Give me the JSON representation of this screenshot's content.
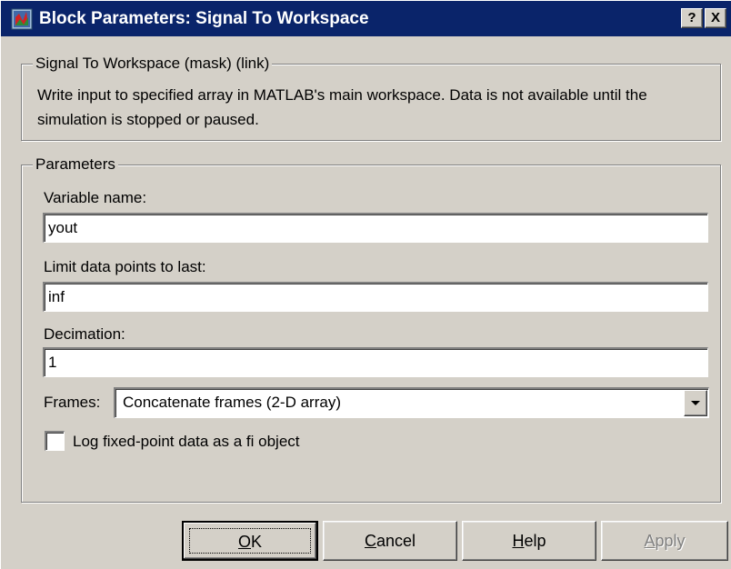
{
  "window": {
    "title": "Block Parameters: Signal To Workspace",
    "help_button": "?",
    "close_button": "X"
  },
  "description_group": {
    "legend": "Signal To Workspace (mask) (link)",
    "text": "Write input to specified array in MATLAB's main workspace.  Data is not available until the simulation is stopped or paused."
  },
  "parameters": {
    "legend": "Parameters",
    "variable_name": {
      "label": "Variable name:",
      "value": "yout"
    },
    "limit_points": {
      "label": "Limit data points to last:",
      "value": "inf"
    },
    "decimation": {
      "label": "Decimation:",
      "value": "1"
    },
    "frames": {
      "label": "Frames:",
      "value": "Concatenate frames (2-D array)"
    },
    "log_fixed_point": {
      "label": "Log fixed-point data as a fi object",
      "checked": false
    }
  },
  "buttons": {
    "ok": {
      "label": "OK",
      "mnemonic": "O",
      "rest": "K"
    },
    "cancel": {
      "label": "Cancel",
      "mnemonic": "C",
      "rest": "ancel"
    },
    "help": {
      "label": "Help",
      "mnemonic": "H",
      "rest": "elp"
    },
    "apply": {
      "label": "Apply",
      "mnemonic": "A",
      "rest": "pply",
      "enabled": false
    }
  },
  "colors": {
    "titlebar": "#0a246a",
    "face": "#d4d0c8",
    "disabled_text": "#808080"
  },
  "icons": [
    "simulink-block-icon",
    "help-icon",
    "close-icon",
    "chevron-down-icon"
  ]
}
